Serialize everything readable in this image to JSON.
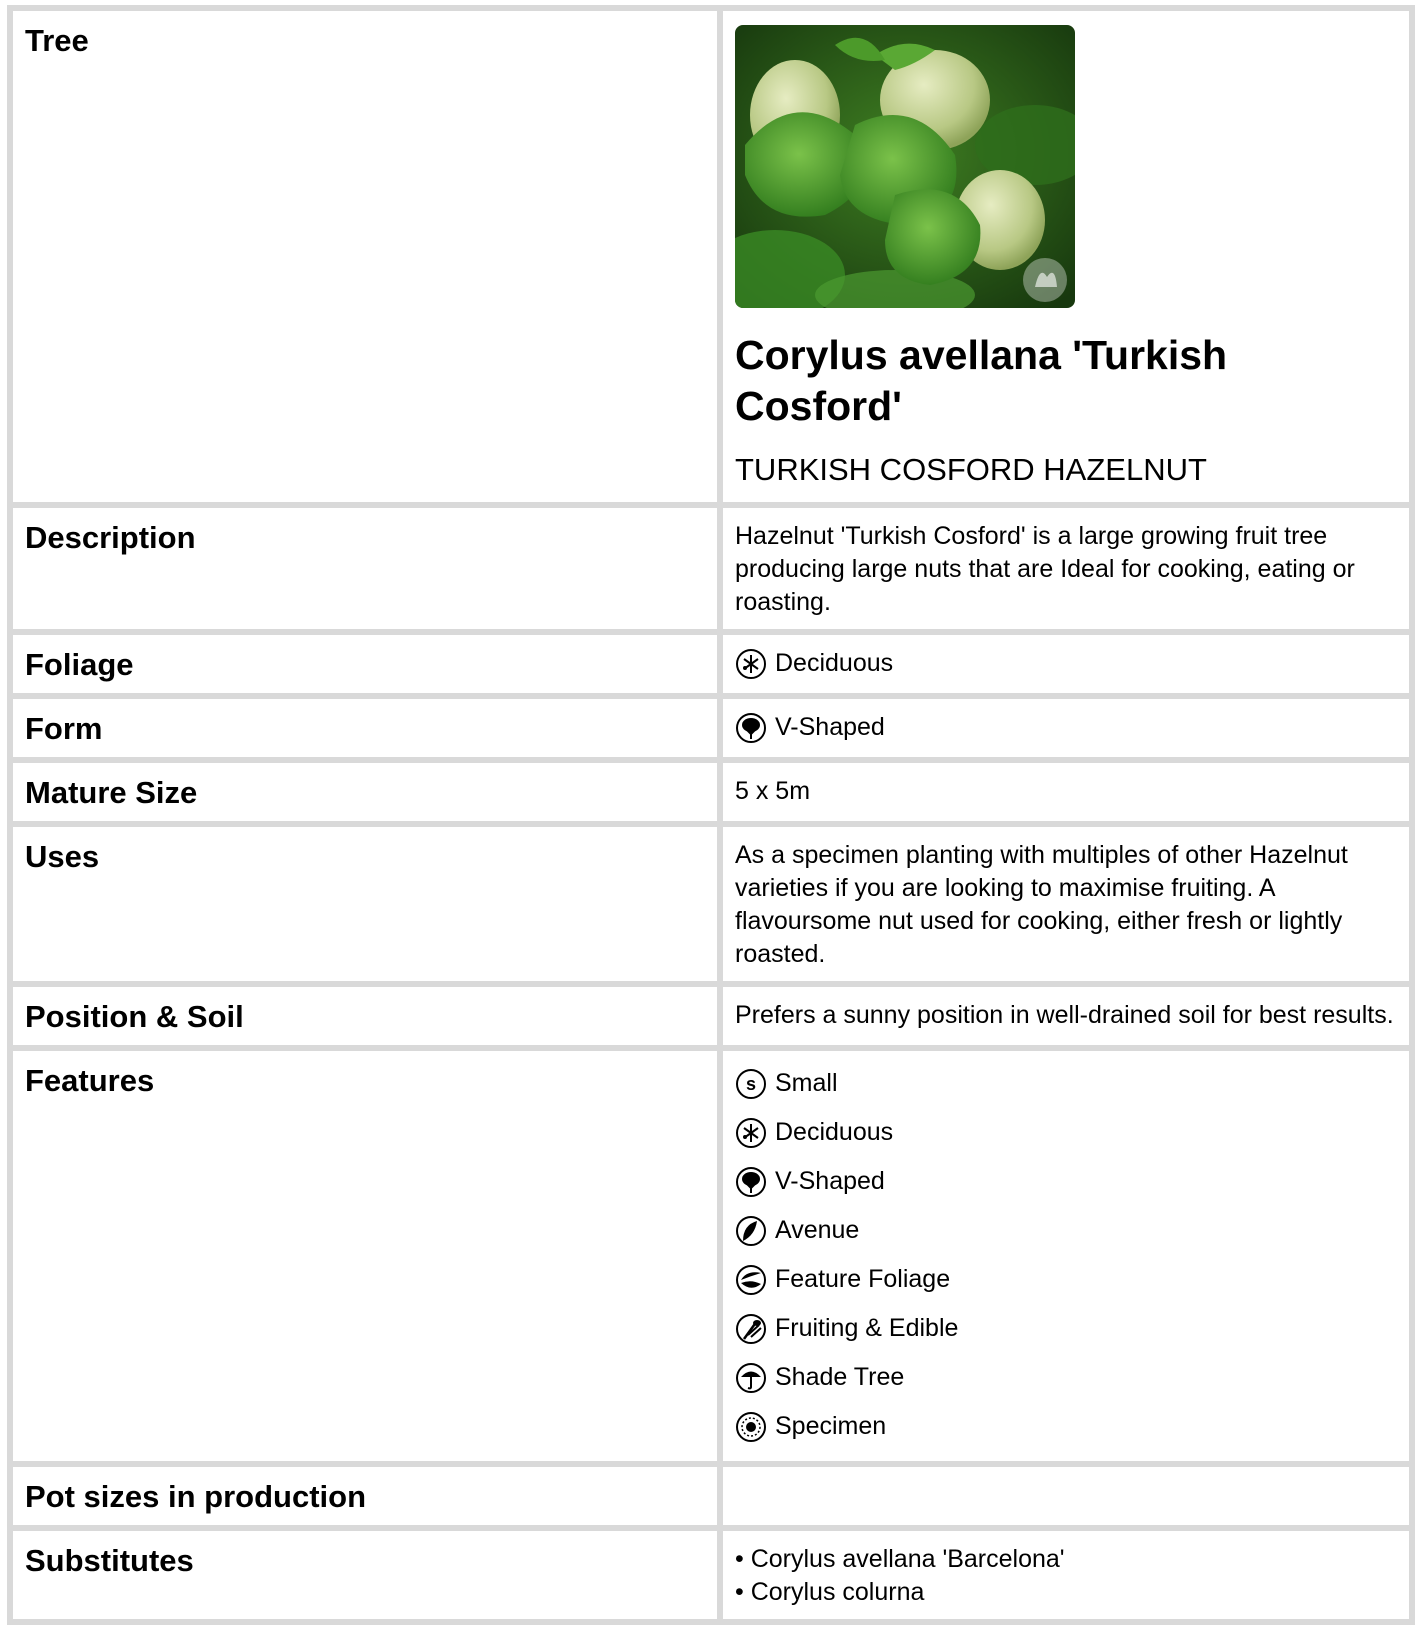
{
  "rows": {
    "tree": {
      "label": "Tree",
      "botanical_name": "Corylus avellana 'Turkish Cosford'",
      "common_name": "TURKISH COSFORD HAZELNUT"
    },
    "description": {
      "label": "Description",
      "text": "Hazelnut 'Turkish Cosford' is a large growing fruit tree producing large nuts that are Ideal for cooking, eating or roasting."
    },
    "foliage": {
      "label": "Foliage",
      "value": "Deciduous",
      "icon": "deciduous-icon"
    },
    "form": {
      "label": "Form",
      "value": "V-Shaped",
      "icon": "v-shaped-icon"
    },
    "mature_size": {
      "label": "Mature Size",
      "value": "5 x 5m"
    },
    "uses": {
      "label": "Uses",
      "text": "As a specimen planting with multiples of other Hazelnut varieties if you are looking to maximise fruiting. A flavoursome nut used for cooking, either fresh or lightly roasted."
    },
    "position_soil": {
      "label": "Position & Soil",
      "text": "Prefers a sunny position in well-drained soil for best results."
    },
    "features": {
      "label": "Features",
      "items": [
        {
          "label": "Small",
          "icon": "small-icon"
        },
        {
          "label": "Deciduous",
          "icon": "deciduous-icon"
        },
        {
          "label": "V-Shaped",
          "icon": "v-shaped-icon"
        },
        {
          "label": "Avenue",
          "icon": "avenue-icon"
        },
        {
          "label": "Feature Foliage",
          "icon": "feature-foliage-icon"
        },
        {
          "label": "Fruiting & Edible",
          "icon": "fruiting-edible-icon"
        },
        {
          "label": "Shade Tree",
          "icon": "shade-tree-icon"
        },
        {
          "label": "Specimen",
          "icon": "specimen-icon"
        }
      ]
    },
    "pot_sizes": {
      "label": "Pot sizes in production",
      "value": ""
    },
    "substitutes": {
      "label": "Substitutes",
      "items": [
        "• Corylus avellana 'Barcelona'",
        "• Corylus colurna"
      ]
    }
  },
  "colors": {
    "grid": "#d9d9d9",
    "leaf_green": "#4f9a2a",
    "nut": "#c9d89a"
  }
}
